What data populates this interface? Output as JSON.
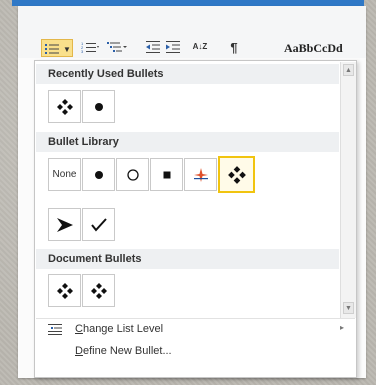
{
  "ribbon": {
    "style_preview": "AaBbCcDd",
    "pilcrow": "¶",
    "sort": "A↓Z"
  },
  "panel": {
    "recent_title": "Recently Used Bullets",
    "library_title": "Bullet Library",
    "document_title": "Document Bullets",
    "none_label": "None",
    "menu": {
      "change_level": {
        "key": "C",
        "rest": "hange List Level"
      },
      "define_new": {
        "key": "D",
        "rest": "efine New Bullet..."
      }
    }
  },
  "colors": {
    "selection_border": "#f1c40f",
    "header_bg": "#eef0f2",
    "bullets_button": "#f9e08b"
  }
}
